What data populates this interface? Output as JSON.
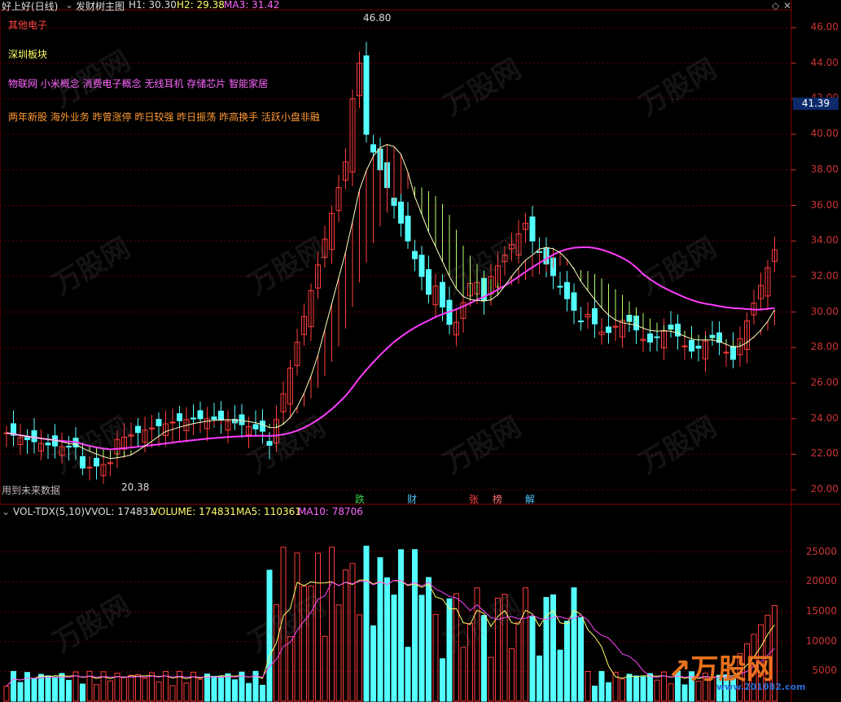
{
  "header": {
    "stock": "好上好(日线)",
    "indicator_menu": "发财树主图",
    "h1": "H1: 30.30",
    "h2": "H2: 29.38",
    "ma3": "MA3: 31.42"
  },
  "tags": {
    "line1": "其他电子",
    "line2": "深圳板块",
    "line3": "物联网 小米概念 消费电子概念 无线耳机 存储芯片 智能家居",
    "line4": "两年新股 海外业务 昨曾涨停 昨日较强 昨日振荡 昨高换手 活跃小盘非融"
  },
  "price_axis": [
    "46.00",
    "44.00",
    "42.00",
    "40.00",
    "38.00",
    "36.00",
    "34.00",
    "32.00",
    "30.00",
    "28.00",
    "26.00",
    "24.00",
    "22.00",
    "20.00"
  ],
  "current_price": "41.39",
  "high_label": "46.80",
  "low_label": "20.38",
  "footnote": "用到未来数据",
  "events": [
    {
      "label": "跌",
      "color": "#3ad24a"
    },
    {
      "label": "财",
      "color": "#4fc3f7"
    },
    {
      "label": "张",
      "color": "#ff4444"
    },
    {
      "label": "榜",
      "color": "#ff7070"
    },
    {
      "label": "解",
      "color": "#4fc3f7"
    }
  ],
  "volume_header": {
    "name": "VOL-TDX(5,10)",
    "vvol": "VVOL: 174831",
    "volume": "VOLUME: 174831",
    "ma5": "MA5: 110361",
    "ma10": "MA10: 78706"
  },
  "volume_axis": [
    "25000",
    "20000",
    "15000",
    "10000",
    "5000"
  ],
  "watermark": "万股网",
  "watermark_url": "www.201082.com",
  "logo_url": "www.201082.com",
  "colors": {
    "up": "#ff3c3c",
    "down": "#54ffff",
    "ma_long": "#ff3cff",
    "ma_short": "#ffffc0",
    "grid": "#7a0000"
  }
}
